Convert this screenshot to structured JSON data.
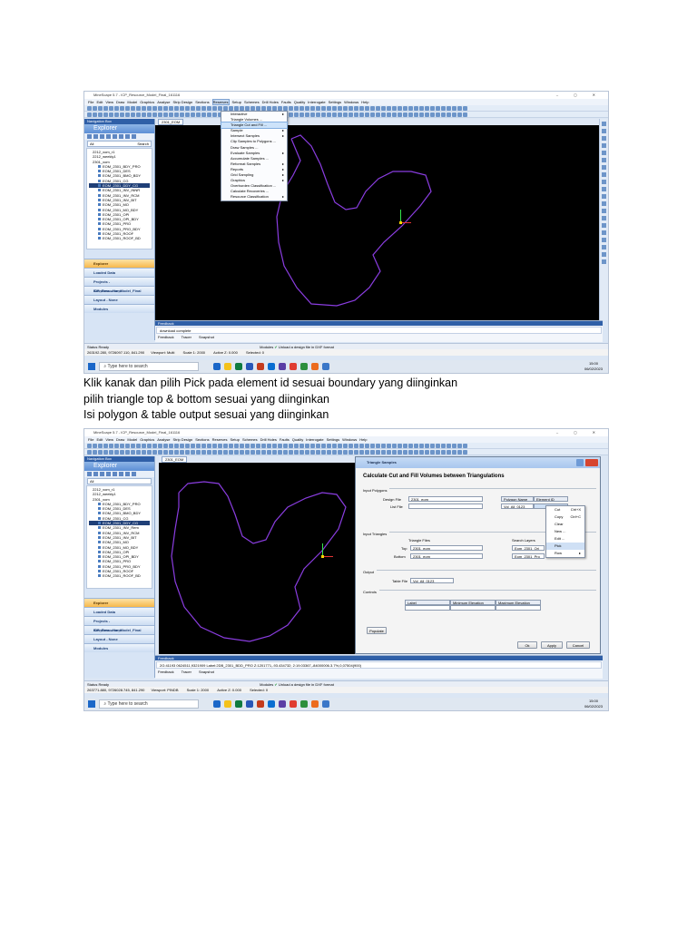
{
  "screenshot1": {
    "window_title": "MineScape 5.7 - ICP_Resource_Model_Final_161116",
    "window_controls": "– ◻ ✕",
    "menu": [
      "File",
      "Edit",
      "View",
      "Draw",
      "Model",
      "Graphics",
      "Analyse",
      "Strip Design",
      "Sections",
      "Reserves",
      "Setup",
      "Schemes",
      "Drill Holes",
      "Faults",
      "Quality",
      "Interrogate",
      "Settings",
      "Windows",
      "Help"
    ],
    "active_menu": "Reserves",
    "nav_header": "Navigation Box",
    "explorer_title": "Explorer",
    "nav_combo": "All",
    "nav_search_label": "Search",
    "tree": [
      {
        "level": 1,
        "label": "2212_xom_r1"
      },
      {
        "level": 1,
        "label": "2212_weekly1"
      },
      {
        "level": 1,
        "label": "2301_xom"
      },
      {
        "level": 2,
        "label": "EOM_2301_BDY_PRO"
      },
      {
        "level": 2,
        "label": "EOM_2301_DES"
      },
      {
        "level": 2,
        "label": "EOM_2301_BMO_BDY"
      },
      {
        "level": 2,
        "label": "EOM_2301_CG"
      },
      {
        "level": 2,
        "label": "EOM_2301_DDY_CG",
        "selected": true
      },
      {
        "level": 2,
        "label": "EOM_2301_INV_INNR"
      },
      {
        "level": 2,
        "label": "EOM_2301_INV_RCM"
      },
      {
        "level": 2,
        "label": "EOM_2301_INV_BIT"
      },
      {
        "level": 2,
        "label": "EOM_2301_MO"
      },
      {
        "level": 2,
        "label": "EOM_2301_MO_BDY"
      },
      {
        "level": 2,
        "label": "EOM_2301_OPI"
      },
      {
        "level": 2,
        "label": "EOM_2301_OPI_BDY"
      },
      {
        "level": 2,
        "label": "EOM_2301_PRO"
      },
      {
        "level": 2,
        "label": "EOM_2301_PRO_BDY"
      },
      {
        "level": 2,
        "label": "EOM_2301_ROOF"
      },
      {
        "level": 2,
        "label": "EOM_2301_ROOF_BD"
      }
    ],
    "nav_sections": [
      "Explorer",
      "Loaded Data",
      "Projects - ICP_Resource_Model_Final",
      "Sessions - None",
      "Layout - None",
      "Modules"
    ],
    "canvas_tab": "2301_EOM",
    "reserves_menu": [
      {
        "label": "Interactive",
        "arrow": true
      },
      {
        "label": "Triangle Volumes ...",
        "arrow": false
      },
      {
        "label": "Triangle Cut and Fill ...",
        "arrow": false,
        "highlight": true
      },
      {
        "label": "Sample",
        "arrow": true
      },
      {
        "label": "Intersect Samples",
        "arrow": true
      },
      {
        "label": "Clip Samples to Polygons ...",
        "arrow": false
      },
      {
        "label": "Draw Samples ...",
        "arrow": false
      },
      {
        "label": "Evaluate Samples",
        "arrow": true
      },
      {
        "label": "Accumulate Samples ...",
        "arrow": false
      },
      {
        "label": "Reformat Samples",
        "arrow": true
      },
      {
        "label": "Reports",
        "arrow": true
      },
      {
        "label": "Grid Sampling",
        "arrow": true
      },
      {
        "label": "Graphics",
        "arrow": true
      },
      {
        "label": "Overburden Classification ...",
        "arrow": false
      },
      {
        "label": "Calculate Recoveries ...",
        "arrow": false
      },
      {
        "label": "Resource Classification",
        "arrow": true
      }
    ],
    "feedback_title": "Feedback",
    "feedback_text": "download complete",
    "feedback_tabs": [
      "Feedback",
      "Tracer",
      "Snapshot"
    ],
    "status_label": "Status",
    "status_value": "Ready",
    "modules_label": "Modules",
    "status_message": "Unload a design file in DXF format",
    "coord_text": "263192.280, 9726097.110, 841.290",
    "viewport_label": "Viewport:",
    "viewport_value": "Multi",
    "scale_label": "Scale 1:",
    "scale_value": "2000",
    "active_label": "Active Z:",
    "active_value": "0.000",
    "selected_label": "Selected:",
    "selected_value": "0",
    "search_placeholder": "Type here to search",
    "clock_time": "15:00",
    "clock_date": "06/02/2023"
  },
  "instructions": [
    "Klik kanak dan pilih Pick pada element id sesuai boundary yang diinginkan",
    "pilih triangle top & bottom sesuai yang diinginkan",
    "Isi polygon & table output sesuai yang diinginkan"
  ],
  "screenshot2": {
    "window_title": "MineScape 5.7 - ICP_Resource_Model_Final_161116",
    "window_controls": "– ◻ ✕",
    "menu": [
      "File",
      "Edit",
      "View",
      "Draw",
      "Model",
      "Graphics",
      "Analyse",
      "Strip Design",
      "Sections",
      "Reserves",
      "Setup",
      "Schemes",
      "Drill Holes",
      "Faults",
      "Quality",
      "Interrogate",
      "Settings",
      "Windows",
      "Help"
    ],
    "nav_header": "Navigation Box",
    "explorer_title": "Explorer",
    "nav_combo": "All",
    "tree": [
      {
        "level": 1,
        "label": "2212_xom_r1"
      },
      {
        "level": 1,
        "label": "2212_weekly1"
      },
      {
        "level": 1,
        "label": "2301_xom"
      },
      {
        "level": 2,
        "label": "EOM_2301_BDY_PRO"
      },
      {
        "level": 2,
        "label": "EOM_2301_DES"
      },
      {
        "level": 2,
        "label": "EOM_2301_BMO_BDY"
      },
      {
        "level": 2,
        "label": "EOM_2301_CG"
      },
      {
        "level": 2,
        "label": "EOM_2301_DDY_CG",
        "selected": true
      },
      {
        "level": 2,
        "label": "EOM_2301_INV_Rem"
      },
      {
        "level": 2,
        "label": "EOM_2301_INV_RCM"
      },
      {
        "level": 2,
        "label": "EOM_2301_INV_BIT"
      },
      {
        "level": 2,
        "label": "EOM_2301_MO"
      },
      {
        "level": 2,
        "label": "EOM_2301_MO_BDY"
      },
      {
        "level": 2,
        "label": "EOM_2301_OPI"
      },
      {
        "level": 2,
        "label": "EOM_2301_OPI_BDY"
      },
      {
        "level": 2,
        "label": "EOM_2301_PRO"
      },
      {
        "level": 2,
        "label": "EOM_2301_PRO_BDY"
      },
      {
        "level": 2,
        "label": "EOM_2301_ROOF"
      },
      {
        "level": 2,
        "label": "EOM_2301_ROOF_BD"
      }
    ],
    "nav_sections": [
      "Explorer",
      "Loaded Data",
      "Projects - ICP_Resource_Model_Final",
      "Sessions - None",
      "Layout - None",
      "Modules"
    ],
    "canvas_tab": "2301_EOM",
    "dialog": {
      "title": "Triangle Samples",
      "heading": "Calculate Cut and Fill Volumes between Triangulations",
      "input_polygons": "Input Polygons",
      "design_file_label": "Design File",
      "design_file_value": "2301_eom",
      "list_file_label": "List File",
      "list_file_value": "",
      "poly_table_headers": [
        "Polygon Name",
        "Element ID"
      ],
      "poly_table_row": [
        "Vol_All_0123",
        ""
      ],
      "input_triangles": "Input Triangles",
      "triangle_files_label": "Triangle Files",
      "search_layers_label": "Search Layers",
      "top_label": "Top",
      "top_value": "2301_eom",
      "top_layer": "Eom_2301_Ori",
      "bottom_label": "Bottom",
      "bottom_value": "2301_eom",
      "bottom_layer": "Eom_2301_Pro",
      "output_label": "Output",
      "table_file_label": "Table File",
      "table_file_value": "Vol_All_0123",
      "controls_label": "Controls",
      "controls_headers": [
        "Label",
        "Minimum Elevation",
        "Maximum Elevation"
      ],
      "populate_label": "Populate",
      "ok_label": "Ok",
      "apply_label": "Apply",
      "cancel_label": "Cancel"
    },
    "context_menu": [
      {
        "label": "Cut",
        "shortcut": "Ctrl+X"
      },
      {
        "label": "Copy",
        "shortcut": "Ctrl+C"
      },
      {
        "label": "Clear",
        "shortcut": ""
      },
      {
        "label": "New ...",
        "shortcut": ""
      },
      {
        "label": "Edit ...",
        "shortcut": ""
      },
      {
        "label": "Pick",
        "shortcut": "",
        "highlight": true
      },
      {
        "label": "Row",
        "shortcut": "▸"
      }
    ],
    "feedback_title": "Feedback",
    "feedback_text": "2G:41193 0624511,9321909 Label:2DB_2301_BDD_PRO Z:1201771,-93.434732; 2:19.03367,-84000006.3.7%,0,07504(900)",
    "feedback_tabs": [
      "Feedback",
      "Tracer",
      "Snapshot"
    ],
    "status_label": "Status",
    "status_value": "Ready",
    "modules_label": "Modules",
    "status_message": "Unload a design file in DXF format",
    "coord_text": "263771.880, 9726028.745, 841.290",
    "viewport_label": "Viewport:",
    "viewport_value": "PINDB",
    "scale_label": "Scale 1:",
    "scale_value": "2000",
    "active_label": "Active Z:",
    "active_value": "0.000",
    "selected_label": "Selected:",
    "selected_value": "0",
    "search_placeholder": "Type here to search",
    "clock_time": "15:00",
    "clock_date": "06/02/2023"
  },
  "colors": {
    "boundary": "#8a3de0",
    "canvas": "#000000",
    "title_blue": "#2f5fa7",
    "highlight": "#cde3fa"
  }
}
